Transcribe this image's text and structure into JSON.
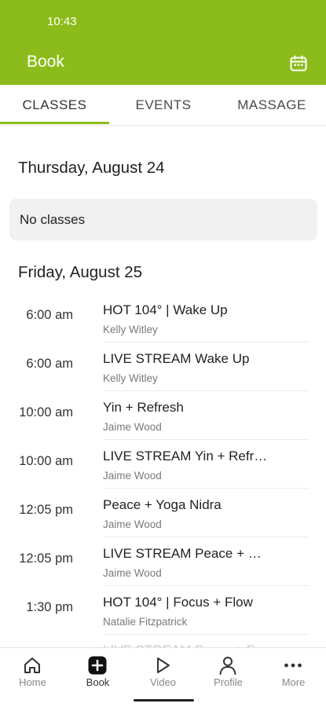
{
  "status_bar": {
    "time": "10:43"
  },
  "app_bar": {
    "title": "Book",
    "calendar_icon": "calendar-icon"
  },
  "tabs": [
    {
      "label": "CLASSES",
      "active": true
    },
    {
      "label": "EVENTS",
      "active": false
    },
    {
      "label": "MASSAGE",
      "active": false
    }
  ],
  "days": [
    {
      "heading": "Thursday, August 24",
      "empty_text": "No classes"
    },
    {
      "heading": "Friday, August 25"
    }
  ],
  "classes": [
    {
      "time": "6:00 am",
      "name": "HOT 104° | Wake Up",
      "instructor": "Kelly Witley"
    },
    {
      "time": "6:00 am",
      "name": "LIVE STREAM Wake Up",
      "instructor": "Kelly Witley"
    },
    {
      "time": "10:00 am",
      "name": "Yin + Refresh",
      "instructor": "Jaime Wood"
    },
    {
      "time": "10:00 am",
      "name": "LIVE STREAM Yin + Refr…",
      "instructor": "Jaime Wood"
    },
    {
      "time": "12:05 pm",
      "name": "Peace + Yoga Nidra",
      "instructor": "Jaime Wood"
    },
    {
      "time": "12:05 pm",
      "name": "LIVE STREAM Peace + …",
      "instructor": "Jaime Wood"
    },
    {
      "time": "1:30 pm",
      "name": "HOT 104° | Focus + Flow",
      "instructor": "Natalie Fitzpatrick"
    }
  ],
  "next_class_peek": "LIVE STREAM Focus + F",
  "bottom_nav": [
    {
      "label": "Home",
      "icon": "home-icon",
      "active": false
    },
    {
      "label": "Book",
      "icon": "plus-square-icon",
      "active": true
    },
    {
      "label": "Video",
      "icon": "play-icon",
      "active": false
    },
    {
      "label": "Profile",
      "icon": "person-icon",
      "active": false
    },
    {
      "label": "More",
      "icon": "more-dots-icon",
      "active": false
    }
  ],
  "colors": {
    "brand": "#8cbc1b",
    "empty_card": "#f1f1f1"
  }
}
